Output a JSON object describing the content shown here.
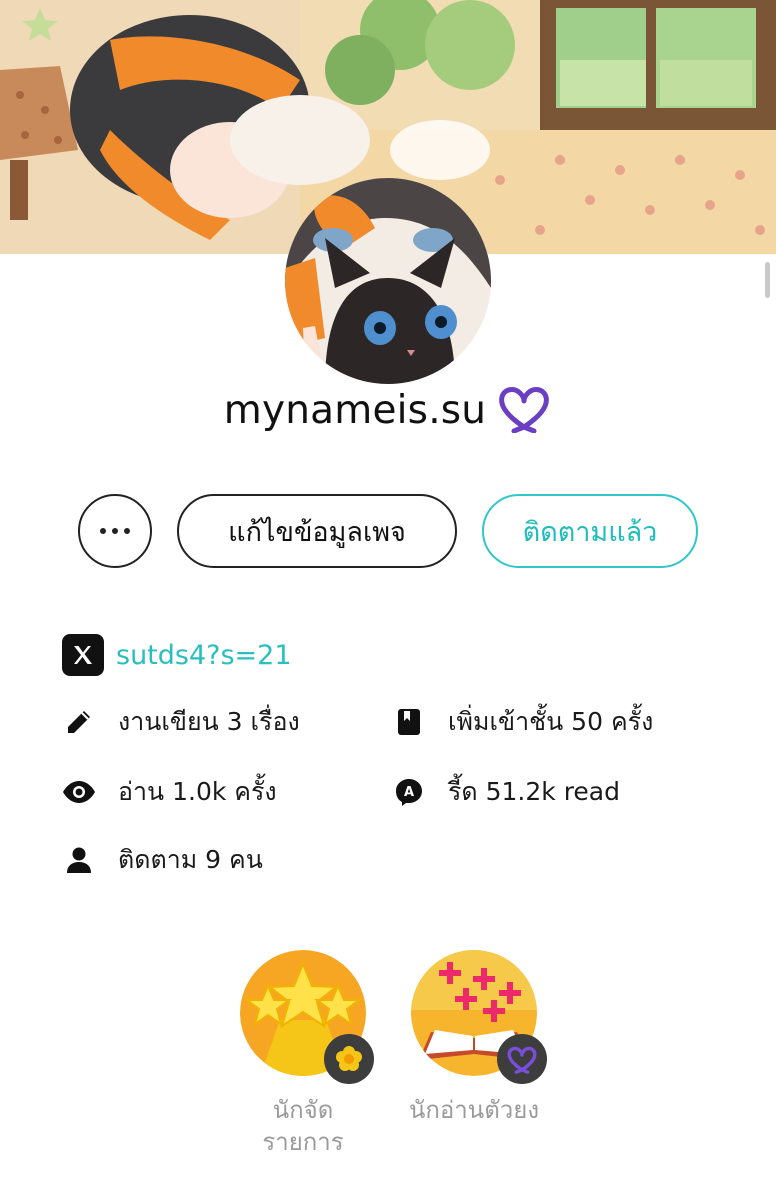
{
  "profile": {
    "username": "mynameis.su",
    "verified_icon": "purple-heart-ribbon-icon"
  },
  "actions": {
    "more_label": "⋯",
    "edit_label": "แก้ไขข้อมูลเพจ",
    "follow_label": "ติดตามแล้ว"
  },
  "social": {
    "icon": "x-logo-icon",
    "handle": "sutds4?s=21"
  },
  "stats": {
    "works": "งานเขียน 3 เรื่อง",
    "shelf_adds": "เพิ่มเข้าชั้น 50 ครั้ง",
    "reads": "อ่าน 1.0k ครั้ง",
    "reader_reads": "รี้ด 51.2k read",
    "followers": "ติดตาม 9 คน"
  },
  "badges": [
    {
      "label_line1": "นักจัด",
      "label_line2": "รายการ",
      "icon": "stars-badge-icon"
    },
    {
      "label_line1": "นักอ่านตัวยง",
      "label_line2": "",
      "icon": "open-book-badge-icon"
    }
  ],
  "colors": {
    "accent": "#2fc7c7",
    "heart": "#6a3fc4",
    "text": "#1a1a1a",
    "muted": "#9a9a9a"
  }
}
